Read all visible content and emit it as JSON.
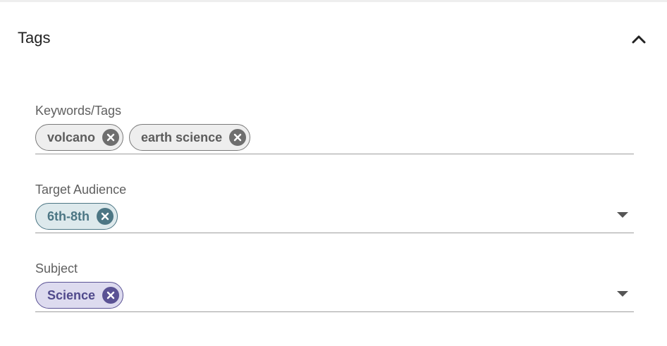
{
  "section": {
    "title": "Tags",
    "toggle_icon": "chevron-up-icon"
  },
  "fields": {
    "keywords": {
      "label": "Keywords/Tags",
      "chips": [
        "volcano",
        "earth science"
      ]
    },
    "audience": {
      "label": "Target Audience",
      "chips": [
        "6th-8th"
      ]
    },
    "subject": {
      "label": "Subject",
      "chips": [
        "Science"
      ]
    }
  },
  "icons": {
    "chip_remove": "close-circle-icon",
    "dropdown": "caret-down-icon",
    "collapse": "chevron-up-icon"
  },
  "colors": {
    "keyword_chip": "#eeeeee",
    "audience_chip": "#dde9ec",
    "subject_chip": "#dddbef",
    "audience_accent": "#4c7684",
    "subject_accent": "#5a5294"
  }
}
